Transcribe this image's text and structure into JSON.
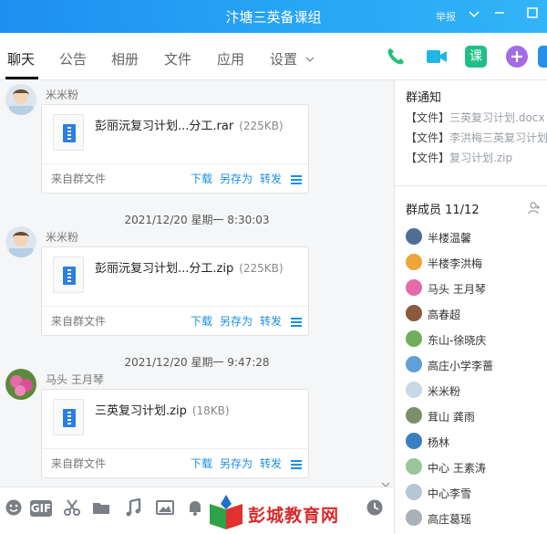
{
  "window": {
    "title": "汴塘三英备课组",
    "report_label": "举报",
    "colors": {
      "titlebar": "#27a6f5",
      "link": "#1a8ee8",
      "watermark": "#d62a2a"
    }
  },
  "tabs": [
    {
      "label": "聊天",
      "active": true
    },
    {
      "label": "公告"
    },
    {
      "label": "相册"
    },
    {
      "label": "文件"
    },
    {
      "label": "应用"
    },
    {
      "label": "设置"
    }
  ],
  "tab_icons": [
    "phone-icon",
    "video-icon",
    "class-icon",
    "add-app-icon"
  ],
  "tab_class_label": "课",
  "chat": {
    "messages": [
      {
        "sender": "米米粉",
        "file_name": "彭丽沅复习计划...分工.rar",
        "file_size": "(225KB)",
        "from": "来自群文件"
      },
      {
        "timestamp": "2021/12/20 星期一 8:30:03",
        "sender": "米米粉",
        "file_name": "彭丽沅复习计划...分工.zip",
        "file_size": "(225KB)",
        "from": "来自群文件"
      },
      {
        "timestamp": "2021/12/20 星期一 9:47:28",
        "sender": "马头 王月琴",
        "file_name": "三英复习计划.zip",
        "file_size": "(18KB)",
        "from": "来自群文件"
      }
    ],
    "actions": {
      "download": "下载",
      "save_as": "另存为",
      "forward": "转发"
    }
  },
  "toolbar": {
    "icons": [
      "emoji-icon",
      "gif-icon",
      "scissors-icon",
      "folder-icon",
      "music-icon",
      "image-icon",
      "bell-icon",
      "history-icon"
    ],
    "gif_label": "GIF",
    "watermark": "彭城教育网"
  },
  "side": {
    "notice_title": "群通知",
    "notices": [
      {
        "tag": "【文件】",
        "file": "三英复习计划.docx"
      },
      {
        "tag": "【文件】",
        "file": "李洪梅三英复习计划.do"
      },
      {
        "tag": "【文件】",
        "file": "复习计划.zip"
      }
    ],
    "members_title": "群成员 11/12",
    "members": [
      "半楼温馨",
      "半楼李洪梅",
      "马头 王月琴",
      "高春超",
      "东山-徐晓庆",
      "高庄小学李蔷",
      "米米粉",
      "茸山 龚雨",
      "杨林",
      "中心 王素涛",
      "中心李雪",
      "高庄葛瑶"
    ]
  }
}
